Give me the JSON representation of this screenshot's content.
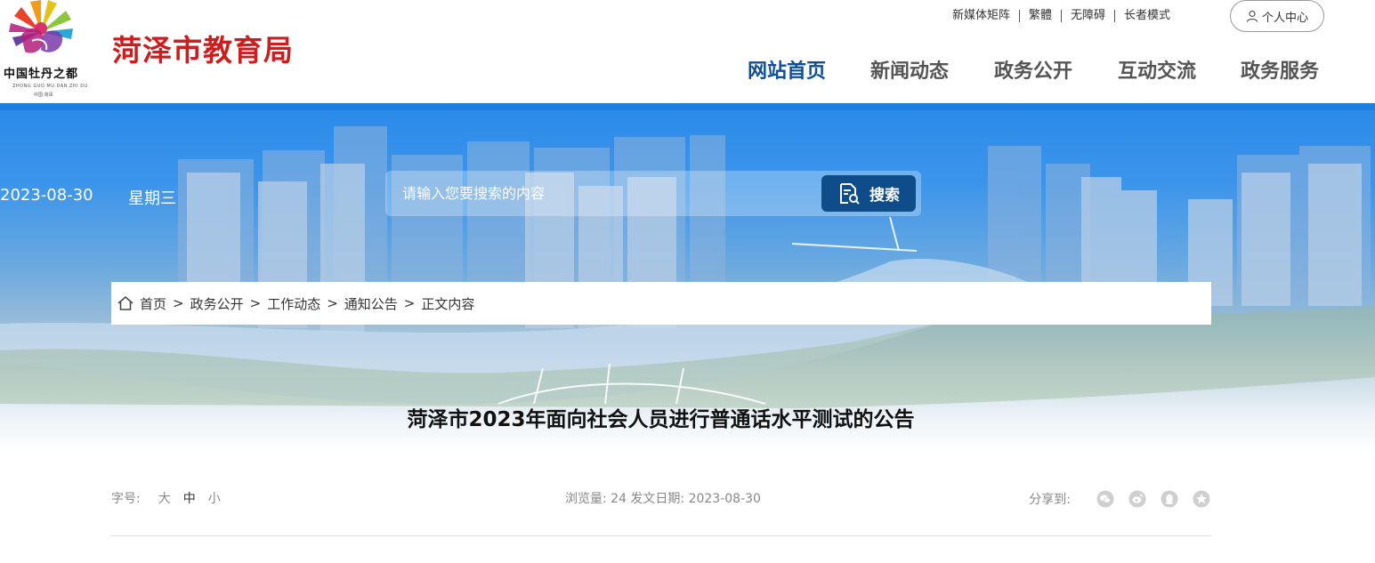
{
  "logo": {
    "text": "中国牡丹之都",
    "sub": "ZHONG GUO MU DAN ZHI DU",
    "sub2": "中国·菏泽"
  },
  "site": {
    "title": "菏泽市教育局"
  },
  "toplinks": [
    "新媒体矩阵",
    "繁體",
    "无障碍",
    "长者模式"
  ],
  "user_center": {
    "label": "个人中心",
    "icon": "user-icon"
  },
  "nav": [
    {
      "label": "网站首页",
      "active": true
    },
    {
      "label": "新闻动态",
      "active": false
    },
    {
      "label": "政务公开",
      "active": false
    },
    {
      "label": "互动交流",
      "active": false
    },
    {
      "label": "政务服务",
      "active": false
    }
  ],
  "banner": {
    "date": "2023-08-30",
    "weekday": "星期三"
  },
  "search": {
    "placeholder": "请输入您要搜索的内容",
    "button_label": "搜索",
    "icon": "search-doc-icon"
  },
  "breadcrumb": {
    "icon": "home-icon",
    "items": [
      "首页",
      "政务公开",
      "工作动态",
      "通知公告",
      "正文内容"
    ],
    "separator": ">"
  },
  "article": {
    "title": "菏泽市2023年面向社会人员进行普通话水平测试的公告"
  },
  "meta": {
    "font_size_label": "字号:",
    "font_sizes": [
      "大",
      "中",
      "小"
    ],
    "views_label": "浏览量: 24 发文日期: 2023-08-30",
    "share_label": "分享到:",
    "share_icons": [
      "wechat-icon",
      "weibo-icon",
      "qq-icon",
      "qzone-icon"
    ]
  },
  "colors": {
    "brand_red": "#d01c1c",
    "nav_active": "#0e4f9c",
    "accent_blue": "#1d7fe0",
    "search_button": "#0f4c8a"
  }
}
